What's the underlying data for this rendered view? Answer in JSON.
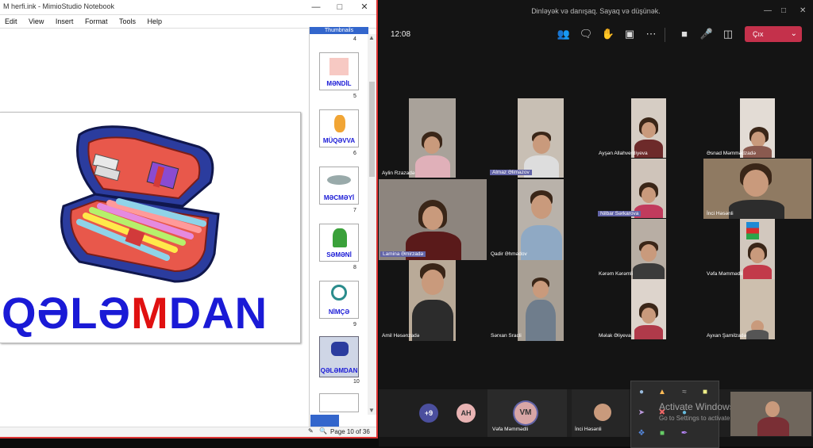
{
  "mimio": {
    "title": "M herfi.ink - MimioStudio Notebook",
    "menu": [
      "Edit",
      "View",
      "Insert",
      "Format",
      "Tools",
      "Help"
    ],
    "word_before": "QƏLƏ",
    "word_highlight": "M",
    "word_after": "DAN",
    "thumbnails_header": "Thumbnails",
    "thumb_numbers": [
      "4",
      "5",
      "6",
      "7",
      "8",
      "9",
      "10"
    ],
    "thumbs": [
      {
        "label": "MƏNDİL"
      },
      {
        "label": "MÜQƏVVA"
      },
      {
        "label": "MƏCMƏYİ"
      },
      {
        "label": "SƏMƏNİ"
      },
      {
        "label": "NİMÇƏ"
      },
      {
        "label": "QƏLƏMDAN"
      }
    ],
    "status_page": "Page 10 of 36",
    "colors": {
      "word_blue": "#1a1ad6",
      "word_red": "#e01111",
      "window_border": "#dd3333"
    }
  },
  "teams": {
    "window_title": "Dinləyək və danışaq. Sayaq və düşünək.",
    "time": "12:08",
    "leave_label": "Çıx",
    "participants": [
      {
        "name": "Aylin Rzazadə"
      },
      {
        "name": "Almaz Əlimazov"
      },
      {
        "name": "Ayşən Allahverdiyeva"
      },
      {
        "name": "Əsnad Məmmədzadə"
      },
      {
        "name": "Lamina Əmirzadə"
      },
      {
        "name": "Qadir Əhmədov"
      },
      {
        "name": "Nilbar Sərkarova"
      },
      {
        "name": "İnci Həsənli"
      },
      {
        "name": "Kərəm Kərəmli"
      },
      {
        "name": "Vəfa Məmmədli"
      },
      {
        "name": "Amil Həsənzadə"
      },
      {
        "name": "Sərxan Sracli"
      },
      {
        "name": "Məlak Əliyeva"
      },
      {
        "name": "Ayxan Şamilzadə"
      }
    ],
    "more_count": "+9",
    "avatar_ah": "AH",
    "avatar_vm": "VM",
    "bottom_name_1": "Vəfa Məmmədli",
    "bottom_name_2": "İnci Həsənli",
    "watermark_1": "Activate Windows",
    "watermark_2": "Go to Settings to activate Windows.",
    "colors": {
      "leave": "#c4314b",
      "accent": "#6264a7"
    }
  }
}
